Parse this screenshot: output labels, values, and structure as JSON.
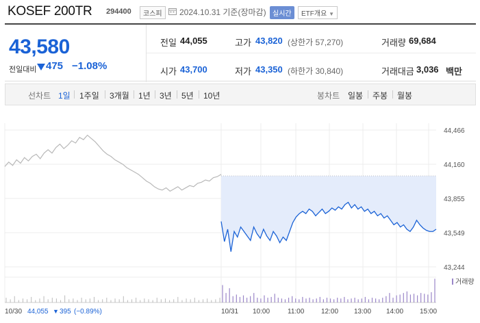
{
  "header": {
    "name": "KOSEF 200TR",
    "code": "294400",
    "market": "코스피",
    "date": "2024.10.31 기준(장마감)",
    "live_label": "실시간",
    "etf_label": "ETF개요"
  },
  "price": {
    "current": "43,580",
    "change_label": "전일대비",
    "change_value": "475",
    "change_percent": "−1.08%",
    "direction": "down"
  },
  "stats": {
    "prev_label": "전일",
    "prev_value": "44,055",
    "high_label": "고가",
    "high_value": "43,820",
    "upper_limit": "(상한가 57,270)",
    "volume_label": "거래량",
    "volume_value": "69,684",
    "open_label": "시가",
    "open_value": "43,700",
    "low_label": "저가",
    "low_value": "43,350",
    "lower_limit": "(하한가 30,840)",
    "amount_label": "거래대금",
    "amount_value": "3,036",
    "amount_unit": "백만"
  },
  "period_bar": {
    "line_label": "선차트",
    "line_periods": [
      "1일",
      "1주일",
      "3개월",
      "1년",
      "3년",
      "5년",
      "10년"
    ],
    "active_period": "1일",
    "candle_label": "봉차트",
    "candle_periods": [
      "일봉",
      "주봉",
      "월봉"
    ]
  },
  "colors": {
    "accent": "#1a62d6",
    "down": "#1a62d6",
    "prev_day_line": "#b8b8b8",
    "fill": "#e4ecfb",
    "volume": "#9a86c8"
  },
  "chart_data": {
    "type": "line",
    "y_ticks": [
      "44,466",
      "44,160",
      "43,855",
      "43,549",
      "43,244"
    ],
    "ylim": [
      43244,
      44466
    ],
    "x_labels": [
      "10/30",
      "10/31",
      "10:00",
      "11:00",
      "12:00",
      "13:00",
      "14:00",
      "15:00"
    ],
    "volume_label": "거래량",
    "footer_date": "10/30",
    "footer_price": "44,055",
    "footer_change": "395",
    "footer_percent": "(−0.89%)",
    "prev_close": 44055,
    "series": [
      {
        "values": [
          44140,
          44180,
          44150,
          44200,
          44170,
          44220,
          44190,
          44230,
          44250,
          44210,
          44260,
          44290,
          44260,
          44310,
          44340,
          44300,
          44330,
          44370,
          44350,
          44400,
          44380,
          44420,
          44390,
          44360,
          44320,
          44280,
          44250,
          44230,
          44200,
          44180,
          44160,
          44130,
          44110,
          44090,
          44070,
          44040,
          44010,
          43990,
          43960,
          43940,
          43930,
          43950,
          43920,
          43940,
          43960,
          43930,
          43950,
          43970,
          43960,
          43990,
          44000,
          44020,
          44010,
          44040,
          44050,
          44070
        ]
      },
      {
        "values": [
          43650,
          43470,
          43580,
          43380,
          43560,
          43510,
          43600,
          43560,
          43520,
          43480,
          43600,
          43540,
          43500,
          43580,
          43520,
          43480,
          43560,
          43520,
          43460,
          43510,
          43480,
          43560,
          43640,
          43690,
          43720,
          43740,
          43720,
          43760,
          43740,
          43700,
          43730,
          43760,
          43720,
          43740,
          43770,
          43750,
          43780,
          43760,
          43800,
          43820,
          43770,
          43800,
          43760,
          43780,
          43740,
          43760,
          43720,
          43740,
          43700,
          43720,
          43680,
          43700,
          43660,
          43620,
          43640,
          43600,
          43620,
          43580,
          43560,
          43600,
          43660,
          43620,
          43590,
          43570,
          43560,
          43560,
          43580
        ]
      }
    ],
    "volume": {
      "prev_day": [
        6,
        4,
        8,
        3,
        5,
        4,
        7,
        3,
        5,
        8,
        4,
        6,
        5,
        3,
        9,
        4,
        5,
        3,
        6,
        4,
        5,
        7,
        3,
        4,
        6,
        3,
        5,
        4,
        8,
        3,
        4,
        6,
        3,
        5,
        4,
        3,
        6,
        4,
        5,
        3,
        4,
        7,
        3,
        5,
        4,
        6,
        3,
        4,
        5,
        3,
        4,
        6
      ],
      "today": [
        22,
        12,
        18,
        8,
        10,
        7,
        9,
        6,
        8,
        12,
        6,
        5,
        9,
        6,
        7,
        11,
        6,
        5,
        4,
        6,
        8,
        5,
        4,
        7,
        5,
        6,
        4,
        5,
        7,
        4,
        6,
        5,
        4,
        6,
        5,
        7,
        4,
        5,
        6,
        4,
        5,
        7,
        4,
        6,
        5,
        4,
        6,
        8,
        12,
        6,
        9,
        10,
        12,
        14,
        10,
        11,
        9,
        12,
        11,
        10,
        13,
        30
      ]
    }
  }
}
